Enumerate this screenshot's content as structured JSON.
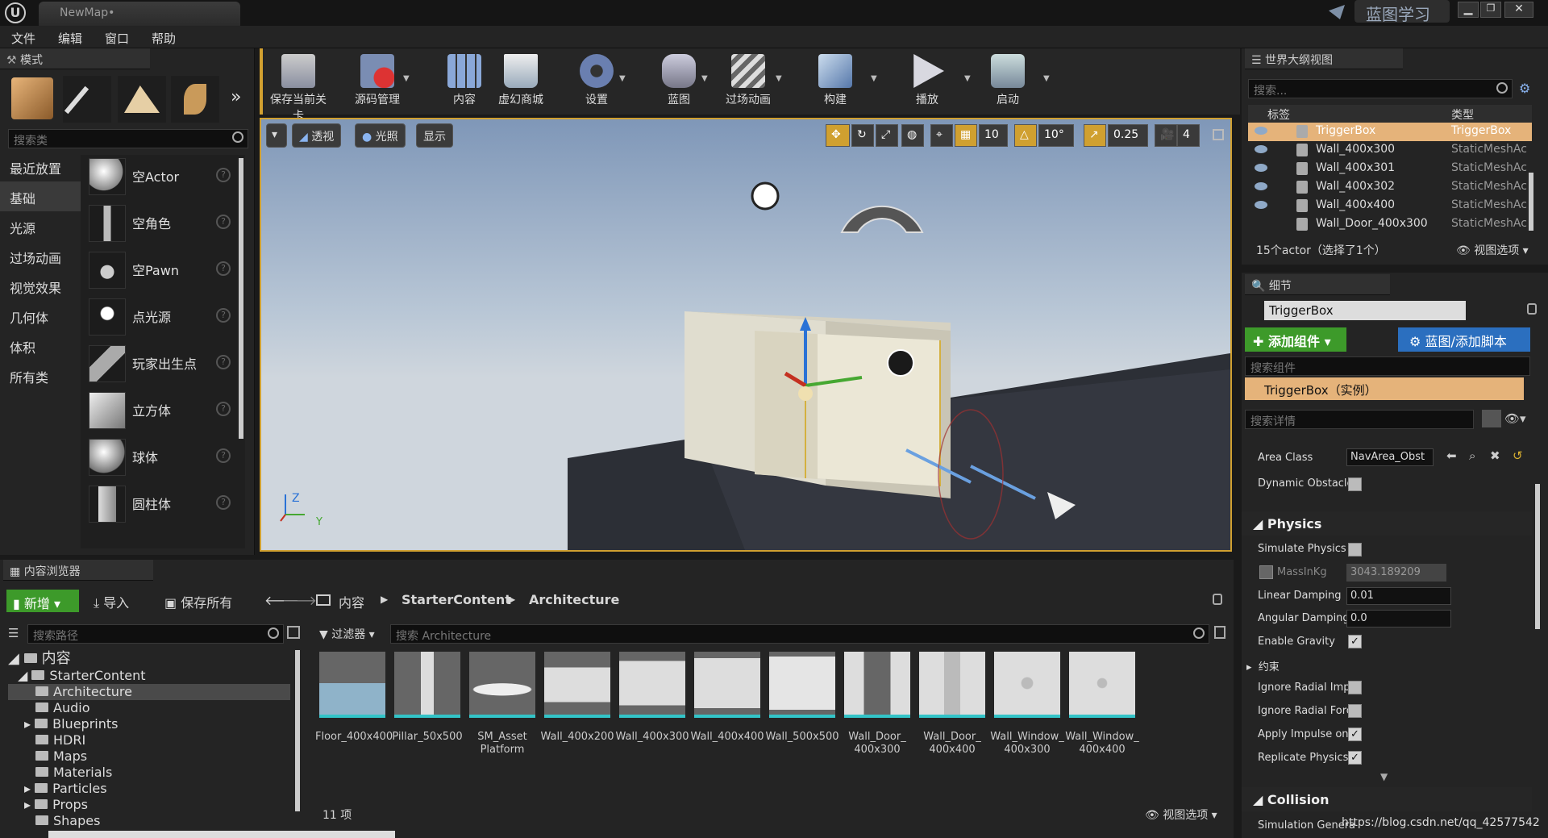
{
  "window": {
    "tab_title": "NewMap•",
    "right_title": "蓝图学习"
  },
  "menu": [
    "文件",
    "编辑",
    "窗口",
    "帮助"
  ],
  "modes": {
    "header": "模式",
    "search_placeholder": "搜索类",
    "categories": [
      "最近放置",
      "基础",
      "光源",
      "过场动画",
      "视觉效果",
      "几何体",
      "体积",
      "所有类"
    ],
    "selected_category": "基础",
    "items": [
      "空Actor",
      "空角色",
      "空Pawn",
      "点光源",
      "玩家出生点",
      "立方体",
      "球体",
      "圆柱体"
    ]
  },
  "toolbar": [
    "保存当前关卡",
    "源码管理",
    "内容",
    "虚幻商城",
    "设置",
    "蓝图",
    "过场动画",
    "构建",
    "播放",
    "启动"
  ],
  "viewport": {
    "perspective": "透视",
    "lit": "光照",
    "show": "显示",
    "grid_snap": "10",
    "rot_snap": "10°",
    "scale_snap": "0.25",
    "cam_speed": "4",
    "axis_z": "Z",
    "axis_y": "Y"
  },
  "outliner": {
    "header": "世界大纲视图",
    "search_placeholder": "搜索...",
    "col_label": "标签",
    "col_type": "类型",
    "rows": [
      {
        "name": "TriggerBox",
        "type": "TriggerBox"
      },
      {
        "name": "Wall_400x300",
        "type": "StaticMeshAc"
      },
      {
        "name": "Wall_400x301",
        "type": "StaticMeshAc"
      },
      {
        "name": "Wall_400x302",
        "type": "StaticMeshAc"
      },
      {
        "name": "Wall_400x400",
        "type": "StaticMeshAc"
      },
      {
        "name": "Wall_Door_400x300",
        "type": "StaticMeshAc"
      }
    ],
    "footer": "15个actor（选择了1个）",
    "view_options": "视图选项"
  },
  "details": {
    "header": "细节",
    "name": "TriggerBox",
    "add_component": "添加组件",
    "blueprint_btn": "蓝图/添加脚本",
    "search_components": "搜索组件",
    "instance": "TriggerBox（实例）",
    "search_details": "搜索详情",
    "area_class_label": "Area Class",
    "area_class_value": "NavArea_Obst",
    "dynamic_obstacle": "Dynamic Obstacle",
    "physics_title": "Physics",
    "simulate_physics": "Simulate Physics",
    "mass_label": "MassInKg",
    "mass_value": "3043.189209",
    "linear_damping": "Linear Damping",
    "linear_damping_value": "0.01",
    "angular_damping": "Angular Damping",
    "angular_damping_value": "0.0",
    "enable_gravity": "Enable Gravity",
    "constraints": "约束",
    "ignore_radial_impulse": "Ignore Radial Impu",
    "ignore_radial_force": "Ignore Radial Forc",
    "apply_impulse": "Apply Impulse on D",
    "replicate_physics": "Replicate Physics",
    "collision_title": "Collision",
    "simulation_generates": "Simulation Genera"
  },
  "content_browser": {
    "header": "内容浏览器",
    "new_btn": "新增",
    "import_btn": "导入",
    "save_all_btn": "保存所有",
    "breadcrumb": [
      "内容",
      "StarterContent",
      "Architecture"
    ],
    "search_path": "搜索路径",
    "filter": "过滤器",
    "search_assets": "搜索 Architecture",
    "tree_root": "内容",
    "tree": [
      "StarterContent",
      "Architecture",
      "Audio",
      "Blueprints",
      "HDRI",
      "Maps",
      "Materials",
      "Particles",
      "Props",
      "Shapes"
    ],
    "assets": [
      [
        "Floor_400x400"
      ],
      [
        "Pillar_50x500"
      ],
      [
        "SM_Asset",
        "Platform"
      ],
      [
        "Wall_400x200"
      ],
      [
        "Wall_400x300"
      ],
      [
        "Wall_400x400"
      ],
      [
        "Wall_500x500"
      ],
      [
        "Wall_Door_",
        "400x300"
      ],
      [
        "Wall_Door_",
        "400x400"
      ],
      [
        "Wall_Window_",
        "400x300"
      ],
      [
        "Wall_Window_",
        "400x400"
      ]
    ],
    "count": "11 项",
    "view_options": "视图选项"
  },
  "watermark": "https://blog.csdn.net/qq_42577542"
}
